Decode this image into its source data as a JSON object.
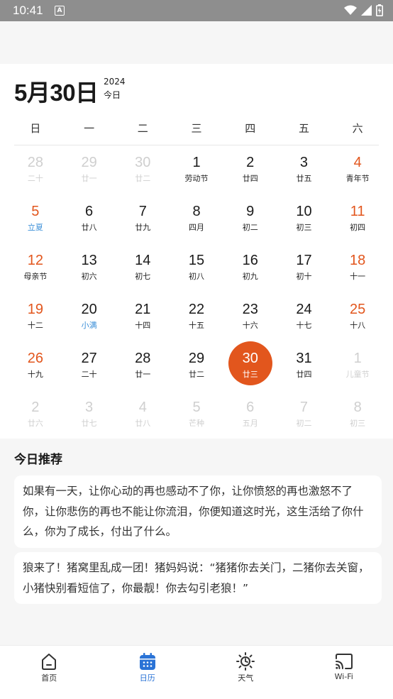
{
  "status_bar": {
    "time": "10:41",
    "notification_icon": "A"
  },
  "calendar": {
    "month_day": "5月30日",
    "year": "2024",
    "today_label": "今日",
    "weekdays": [
      "日",
      "一",
      "二",
      "三",
      "四",
      "五",
      "六"
    ],
    "weeks": [
      [
        {
          "n": "28",
          "l": "二十",
          "t": "other"
        },
        {
          "n": "29",
          "l": "廿一",
          "t": "other"
        },
        {
          "n": "30",
          "l": "廿二",
          "t": "other"
        },
        {
          "n": "1",
          "l": "劳动节",
          "t": ""
        },
        {
          "n": "2",
          "l": "廿四",
          "t": ""
        },
        {
          "n": "3",
          "l": "廿五",
          "t": ""
        },
        {
          "n": "4",
          "l": "青年节",
          "t": "weekend"
        }
      ],
      [
        {
          "n": "5",
          "l": "立夏",
          "t": "weekend term"
        },
        {
          "n": "6",
          "l": "廿八",
          "t": ""
        },
        {
          "n": "7",
          "l": "廿九",
          "t": ""
        },
        {
          "n": "8",
          "l": "四月",
          "t": ""
        },
        {
          "n": "9",
          "l": "初二",
          "t": ""
        },
        {
          "n": "10",
          "l": "初三",
          "t": ""
        },
        {
          "n": "11",
          "l": "初四",
          "t": "weekend"
        }
      ],
      [
        {
          "n": "12",
          "l": "母亲节",
          "t": "weekend"
        },
        {
          "n": "13",
          "l": "初六",
          "t": ""
        },
        {
          "n": "14",
          "l": "初七",
          "t": ""
        },
        {
          "n": "15",
          "l": "初八",
          "t": ""
        },
        {
          "n": "16",
          "l": "初九",
          "t": ""
        },
        {
          "n": "17",
          "l": "初十",
          "t": ""
        },
        {
          "n": "18",
          "l": "十一",
          "t": "weekend"
        }
      ],
      [
        {
          "n": "19",
          "l": "十二",
          "t": "weekend"
        },
        {
          "n": "20",
          "l": "小满",
          "t": "term"
        },
        {
          "n": "21",
          "l": "十四",
          "t": ""
        },
        {
          "n": "22",
          "l": "十五",
          "t": ""
        },
        {
          "n": "23",
          "l": "十六",
          "t": ""
        },
        {
          "n": "24",
          "l": "十七",
          "t": ""
        },
        {
          "n": "25",
          "l": "十八",
          "t": "weekend"
        }
      ],
      [
        {
          "n": "26",
          "l": "十九",
          "t": "weekend"
        },
        {
          "n": "27",
          "l": "二十",
          "t": ""
        },
        {
          "n": "28",
          "l": "廿一",
          "t": ""
        },
        {
          "n": "29",
          "l": "廿二",
          "t": ""
        },
        {
          "n": "30",
          "l": "廿三",
          "t": "today"
        },
        {
          "n": "31",
          "l": "廿四",
          "t": ""
        },
        {
          "n": "1",
          "l": "儿童节",
          "t": "other"
        }
      ],
      [
        {
          "n": "2",
          "l": "廿六",
          "t": "other"
        },
        {
          "n": "3",
          "l": "廿七",
          "t": "other"
        },
        {
          "n": "4",
          "l": "廿八",
          "t": "other"
        },
        {
          "n": "5",
          "l": "芒种",
          "t": "other"
        },
        {
          "n": "6",
          "l": "五月",
          "t": "other"
        },
        {
          "n": "7",
          "l": "初二",
          "t": "other"
        },
        {
          "n": "8",
          "l": "初三",
          "t": "other"
        }
      ]
    ],
    "colors": {
      "accent": "#e2561d",
      "term": "#3b8fd8",
      "muted": "#cfcfcf"
    }
  },
  "recommend": {
    "title": "今日推荐",
    "quotes": [
      "如果有一天，让你心动的再也感动不了你，让你愤怒的再也激怒不了你，让你悲伤的再也不能让你流泪，你便知道这时光，这生活给了你什么，你为了成长，付出了什么。",
      "狼来了！猪窝里乱成一团！猪妈妈说：“猪猪你去关门，二猪你去关窗，小猪快别看短信了，你最靓！你去勾引老狼！”"
    ]
  },
  "nav": {
    "items": [
      {
        "label": "首页",
        "icon": "home-icon"
      },
      {
        "label": "日历",
        "icon": "calendar-icon"
      },
      {
        "label": "天气",
        "icon": "weather-sun-icon"
      },
      {
        "label": "Wi-Fi",
        "icon": "cast-wifi-icon"
      }
    ],
    "active_index": 1,
    "active_color": "#2a73d6"
  }
}
